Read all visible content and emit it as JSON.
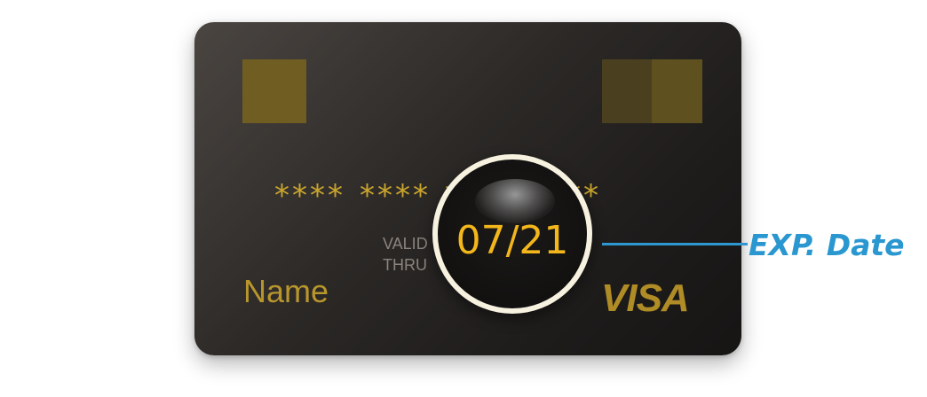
{
  "card": {
    "number_groups": [
      "****",
      "****",
      "****",
      "****"
    ],
    "valid_label_line1": "VALID",
    "valid_label_line2": "THRU",
    "holder_name": "Name",
    "network": "VISA"
  },
  "magnifier": {
    "expiry_date": "07/21"
  },
  "callout": {
    "label": "EXP. Date"
  },
  "colors": {
    "gold": "#c9a52d",
    "expiry_gold": "#f3b71b",
    "callout_blue": "#2a97d0",
    "card_dark": "#1e1c1b"
  }
}
